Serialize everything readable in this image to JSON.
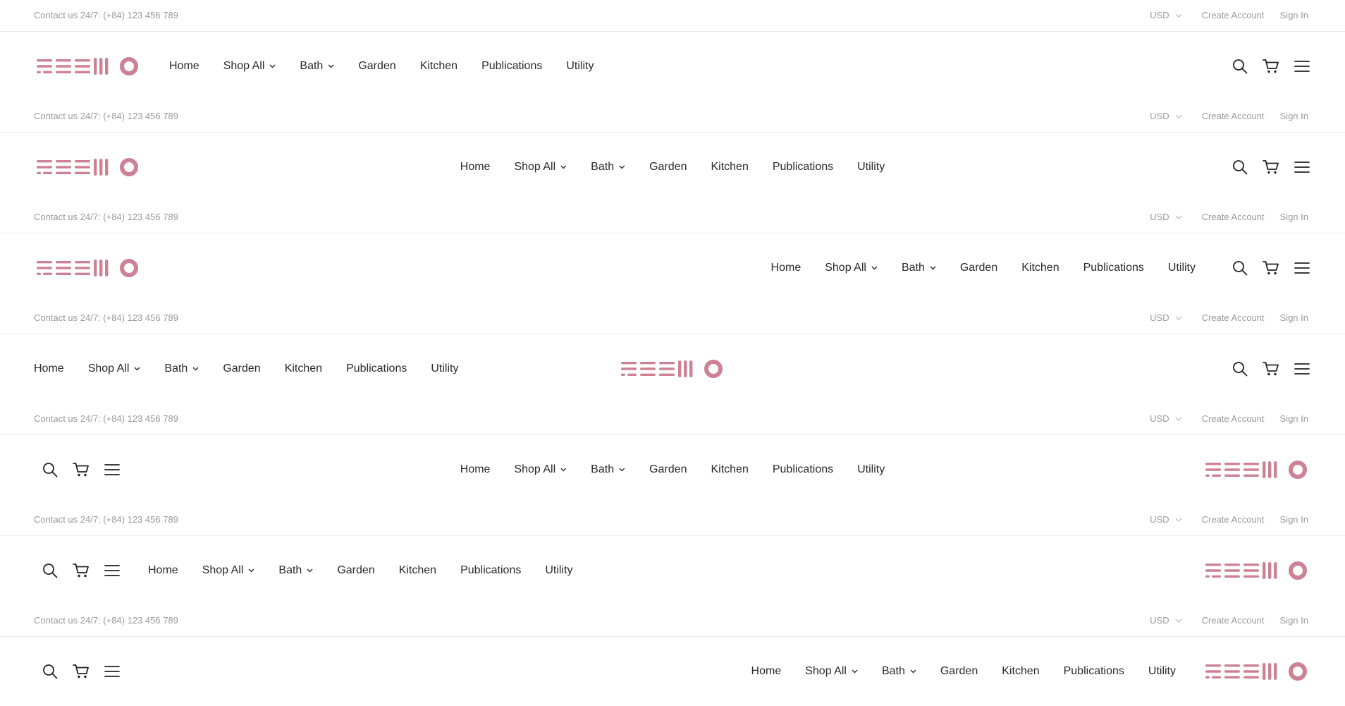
{
  "brand": {
    "accent": "#cc8293"
  },
  "topbar": {
    "contact": "Contact us 24/7: (+84) 123 456 789",
    "currency": "USD",
    "create_account": "Create Account",
    "sign_in": "Sign In"
  },
  "nav": [
    {
      "label": "Home",
      "dropdown": false
    },
    {
      "label": "Shop All",
      "dropdown": true
    },
    {
      "label": "Bath",
      "dropdown": true
    },
    {
      "label": "Garden",
      "dropdown": false
    },
    {
      "label": "Kitchen",
      "dropdown": false
    },
    {
      "label": "Publications",
      "dropdown": false
    },
    {
      "label": "Utility",
      "dropdown": false
    }
  ],
  "icons": [
    "search-icon",
    "cart-icon",
    "menu-icon"
  ],
  "variants": [
    {
      "id": "logo-left-nav-left-icons-right"
    },
    {
      "id": "logo-left-nav-center-icons-right"
    },
    {
      "id": "logo-left-nav-right-icons-right"
    },
    {
      "id": "nav-left-logo-center-icons-right"
    },
    {
      "id": "icons-left-nav-center-logo-right"
    },
    {
      "id": "icons-left-nav-left-logo-right"
    },
    {
      "id": "icons-left-nav-right-logo-right"
    }
  ]
}
